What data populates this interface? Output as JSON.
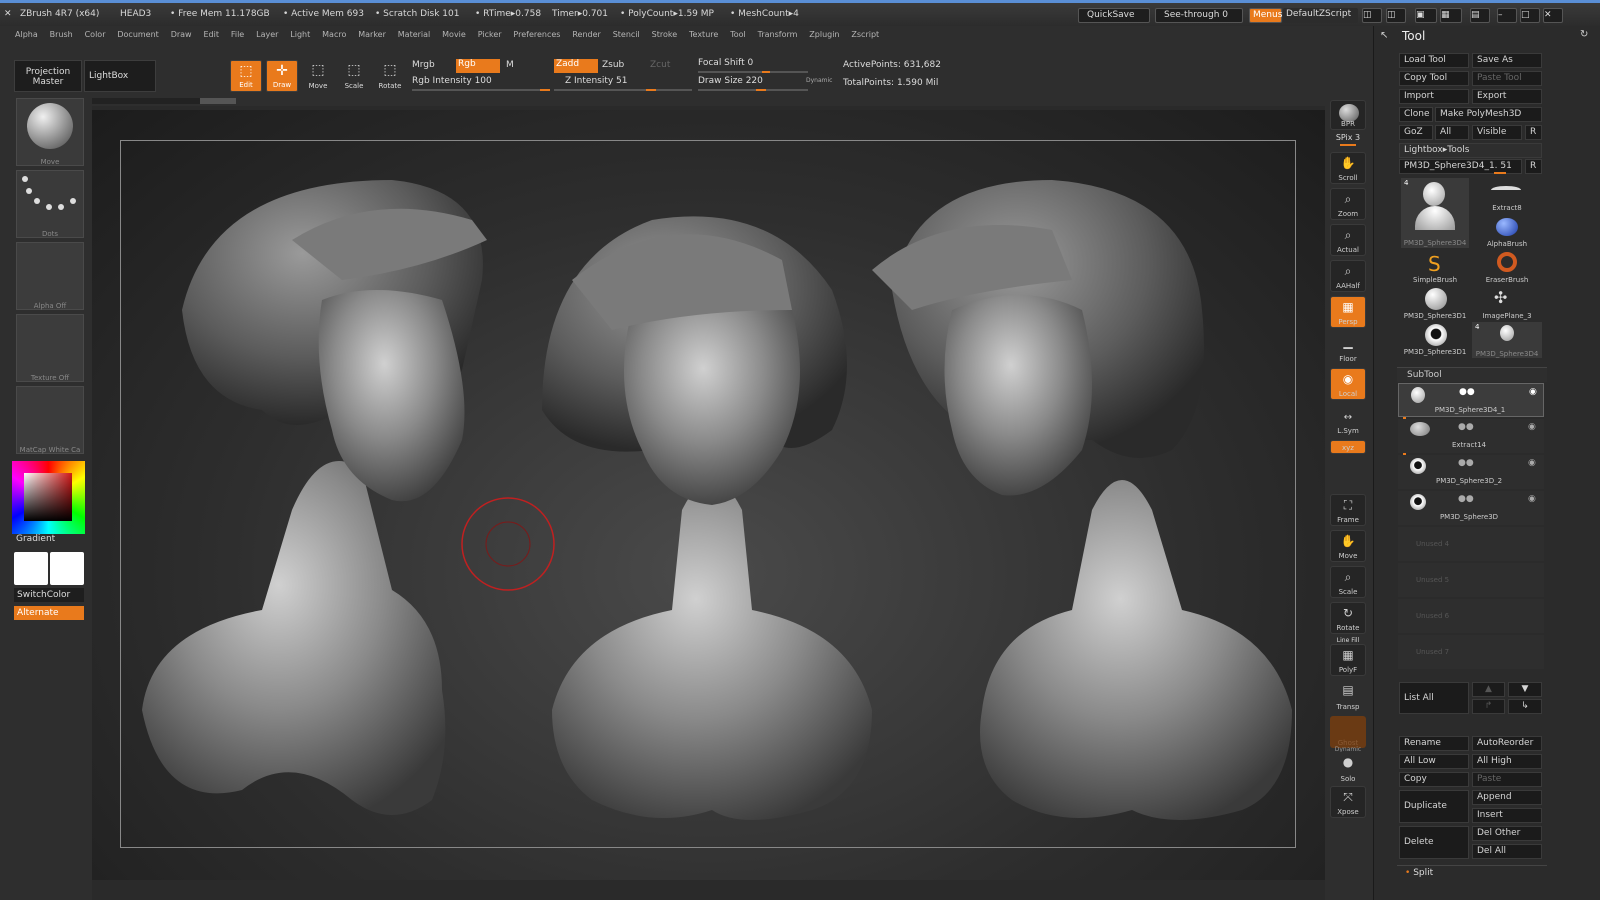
{
  "titlebar": {
    "app": "ZBrush 4R7 (x64)",
    "doc": "HEAD3",
    "free_mem": "• Free Mem 11.178GB",
    "active_mem": "• Active Mem 693",
    "scratch": "• Scratch Disk 101",
    "rtime": "• RTime▸0.758",
    "timer": "Timer▸0.701",
    "polycount": "• PolyCount▸1.59 MP",
    "meshcount": "• MeshCount▸4",
    "quicksave": "QuickSave",
    "seethrough": "See-through  0",
    "menus": "Menus",
    "script": "DefaultZScript"
  },
  "menubar": [
    "Alpha",
    "Brush",
    "Color",
    "Document",
    "Draw",
    "Edit",
    "File",
    "Layer",
    "Light",
    "Macro",
    "Marker",
    "Material",
    "Movie",
    "Picker",
    "Preferences",
    "Render",
    "Stencil",
    "Stroke",
    "Texture",
    "Tool",
    "Transform",
    "Zplugin",
    "Zscript"
  ],
  "shelf": {
    "projection_master": "Projection Master",
    "lightbox": "LightBox",
    "edit": "Edit",
    "draw": "Draw",
    "move": "Move",
    "scale": "Scale",
    "rotate": "Rotate",
    "mrgb": "Mrgb",
    "rgb": "Rgb",
    "m": "M",
    "rgb_intensity": "Rgb  Intensity 100",
    "zadd": "Zadd",
    "zsub": "Zsub",
    "zcut": "Zcut",
    "z_intensity": "Z Intensity 51",
    "focal_shift": "Focal Shift 0",
    "draw_size": "Draw Size 220",
    "dynamic": "Dynamic",
    "active_points": "ActivePoints: 631,682",
    "total_points": "TotalPoints: 1.590 Mil"
  },
  "lefttray": {
    "move": "Move",
    "dots": "Dots",
    "alpha_off": "Alpha  Off",
    "texture_off": "Texture  Off",
    "matcap": "MatCap  White  Ca",
    "gradient": "Gradient",
    "switchcolor": "SwitchColor",
    "alternate": "Alternate"
  },
  "rightshelf": [
    "BPR",
    "SPix 3",
    "Scroll",
    "Zoom",
    "Actual",
    "AAHalf",
    "Persp",
    "Floor",
    "Local",
    "L.Sym",
    "xyz",
    "Frame",
    "Move",
    "Scale",
    "Rotate",
    "Line Fill",
    "PolyF",
    "Transp",
    "Ghost",
    "Dynamic",
    "Solo",
    "Xpose"
  ],
  "toolpanel": {
    "title": "Tool",
    "load_tool": "Load  Tool",
    "save_as": "Save  As",
    "copy_tool": "Copy  Tool",
    "paste_tool": "Paste  Tool",
    "import": "Import",
    "export": "Export",
    "clone": "Clone",
    "make_polymesh": "Make  PolyMesh3D",
    "goz": "GoZ",
    "all": "All",
    "visible": "Visible",
    "r": "R",
    "lightbox_tools": "Lightbox▸Tools",
    "current_tool": "PM3D_Sphere3D4_1. 51",
    "tools": [
      "PM3D_Sphere3D4",
      "Extract8",
      "AlphaBrush",
      "SimpleBrush",
      "EraserBrush",
      "PM3D_Sphere3D1",
      "ImagePlane_3",
      "PM3D_Sphere3D1",
      "PM3D_Sphere3D4"
    ],
    "subtool_title": "SubTool",
    "subtools": [
      "PM3D_Sphere3D4_1",
      "Extract14",
      "PM3D_Sphere3D_2",
      "PM3D_Sphere3D",
      "Unused  4",
      "Unused  5",
      "Unused  6",
      "Unused  7"
    ],
    "list_all": "List  All",
    "rename": "Rename",
    "autoreorder": "AutoReorder",
    "all_low": "All  Low",
    "all_high": "All  High",
    "copy": "Copy",
    "paste": "Paste",
    "duplicate": "Duplicate",
    "append": "Append",
    "insert": "Insert",
    "delete": "Delete",
    "del_other": "Del  Other",
    "del_all": "Del  All",
    "split": "Split",
    "tool_count": "4"
  },
  "colors": {
    "accent": "#e97a1c",
    "bg": "#2e2e2e",
    "viewport": "#1c1c1c"
  }
}
